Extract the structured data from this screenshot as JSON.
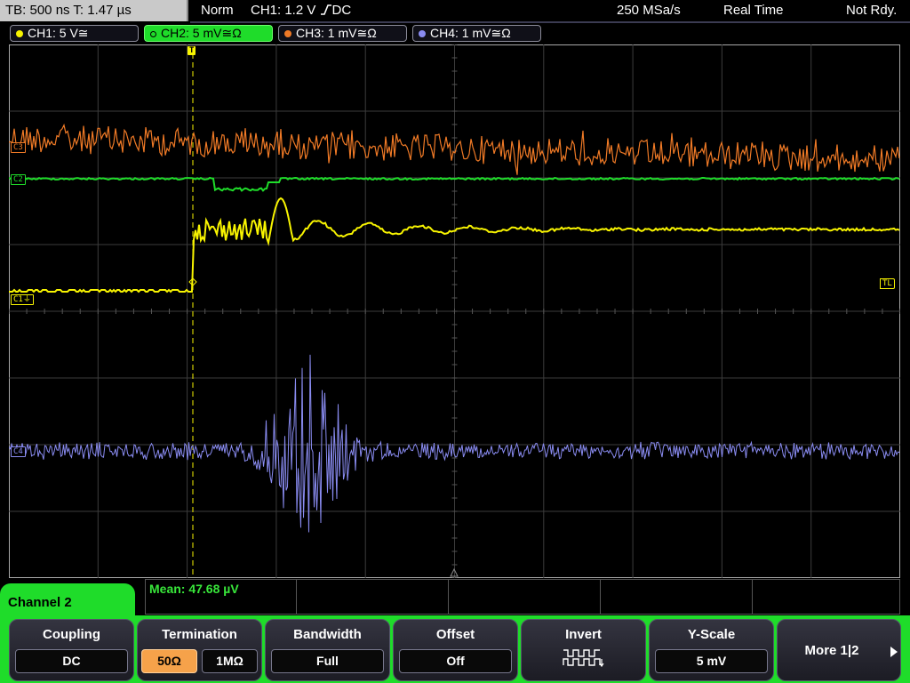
{
  "status_bar": {
    "timebase": "TB: 500 ns   T: 1.47 µs",
    "trigger_mode": "Norm",
    "trigger_source": "CH1: 1.2 V",
    "trigger_coupling": "DC",
    "sample_rate": "250 MSa/s",
    "acquisition_mode": "Real Time",
    "acquisition_status": "Not Rdy."
  },
  "channels": [
    {
      "id": "CH1",
      "label": "CH1: 5 V≅",
      "color": "#f8f400",
      "active": false
    },
    {
      "id": "CH2",
      "label": "CH2: 5 mV≅Ω",
      "color": "#1fdc2a",
      "active": true
    },
    {
      "id": "CH3",
      "label": "CH3: 1 mV≅Ω",
      "color": "#f07a26",
      "active": false
    },
    {
      "id": "CH4",
      "label": "CH4: 1 mV≅Ω",
      "color": "#8a8cf2",
      "active": false
    }
  ],
  "grid_markers": {
    "ch1_marker": "C1⏚",
    "ch2_marker": "C2",
    "ch3_marker": "C3",
    "ch4_marker": "C4",
    "trigger_level_marker": "TL",
    "trigger_position_marker": "T"
  },
  "measurement": {
    "mean_label": "Mean: 47.68 µV"
  },
  "menu": {
    "title": "Channel 2",
    "softkeys": [
      {
        "title": "Coupling",
        "value": "DC"
      },
      {
        "title": "Termination",
        "options": [
          "50Ω",
          "1MΩ"
        ],
        "selected": "50Ω"
      },
      {
        "title": "Bandwidth",
        "value": "Full"
      },
      {
        "title": "Offset",
        "value": "Off"
      },
      {
        "title": "Invert",
        "icon": "inverted-square-wave-icon"
      },
      {
        "title": "Y-Scale",
        "value": "5 mV"
      },
      {
        "title": "More 1|2",
        "icon": "right-arrow-icon"
      }
    ]
  },
  "colors": {
    "ch1": "#f8f400",
    "ch2": "#1fdc2a",
    "ch3": "#f07a26",
    "ch4": "#8a8cf2",
    "selected_option": "#f6a24a"
  }
}
